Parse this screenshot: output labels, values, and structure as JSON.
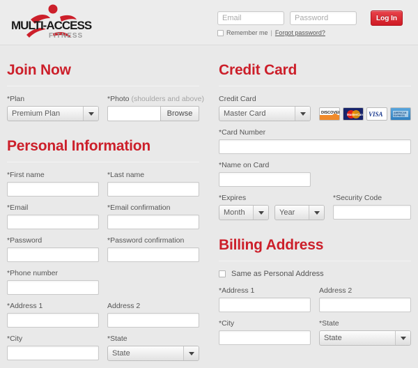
{
  "brand": {
    "name_top": "MULTI-ACCESS",
    "name_bottom": "FITNESS",
    "accent_color": "#cc1f2a",
    "logo_text_color": "#1a1a1a",
    "sub_text_color": "#9b9b9b"
  },
  "login": {
    "email_placeholder": "Email",
    "password_placeholder": "Password",
    "email_value": "",
    "password_value": "",
    "login_button": "Log In",
    "remember_label": "Remember me",
    "separator": "|",
    "forgot_link": "Forgot password?"
  },
  "join": {
    "heading": "Join Now",
    "plan_label": "*Plan",
    "plan_value": "Premium Plan",
    "photo_label": "*Photo",
    "photo_hint": "(shoulders and above)",
    "photo_value": "",
    "browse_button": "Browse"
  },
  "personal": {
    "heading": "Personal Information",
    "first_name_label": "*First name",
    "first_name_value": "",
    "last_name_label": "*Last name",
    "last_name_value": "",
    "email_label": "*Email",
    "email_value": "",
    "email_confirm_label": "*Email confirmation",
    "email_confirm_value": "",
    "password_label": "*Password",
    "password_value": "",
    "password_confirm_label": "*Password confirmation",
    "password_confirm_value": "",
    "phone_label": "*Phone number",
    "phone_value": "",
    "address1_label": "*Address 1",
    "address1_value": "",
    "address2_label": "Address 2",
    "address2_value": "",
    "city_label": "*City",
    "city_value": "",
    "state_label": "*State",
    "state_value": "State"
  },
  "credit_card": {
    "heading": "Credit Card",
    "type_label": "Credit Card",
    "type_value": "Master Card",
    "accepted_cards": [
      "DISCOVER",
      "MasterCard",
      "VISA",
      "AMERICAN EXPRESS"
    ],
    "number_label": "*Card Number",
    "number_value": "",
    "name_label": "*Name on Card",
    "name_value": "",
    "expires_label": "*Expires",
    "month_value": "Month",
    "year_value": "Year",
    "security_label": "*Security Code",
    "security_value": ""
  },
  "billing": {
    "heading": "Billing Address",
    "same_as_personal_label": "Same as Personal Address",
    "address1_label": "*Address 1",
    "address1_value": "",
    "address2_label": "Address 2",
    "address2_value": "",
    "city_label": "*City",
    "city_value": "",
    "state_label": "*State",
    "state_value": "State"
  }
}
